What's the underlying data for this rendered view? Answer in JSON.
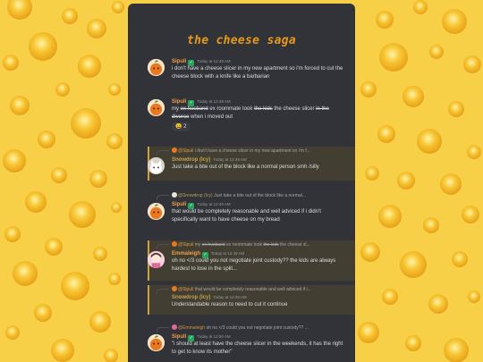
{
  "page": {
    "title": "the cheese saga"
  },
  "messages": [
    {
      "user": "Sipuli",
      "time": "Today at 12:48 AM",
      "text": "i don't have a cheese slicer in my new apartment so i'm forced to cut the cheese block with a knife like a barbarian"
    },
    {
      "user": "Sipuli",
      "time": "Today at 12:48 AM",
      "text_parts": [
        "my ",
        "ex husband",
        " ex roommate took ",
        "the kids",
        " the cheese slicer ",
        "in the divorce",
        " when i moved out"
      ],
      "reaction": {
        "emoji": "😩",
        "count": "2"
      }
    },
    {
      "reply_user": "@Sipuli",
      "reply_text": "i don't have a cheese slicer in my new apartment so i'm f...",
      "user": "Snowdrop (Icy)",
      "time": "Today at 12:49 AM",
      "text": "Just take a bite out of the block like a normal person smh /silly"
    },
    {
      "reply_user": "@Snowdrop (Icy)",
      "reply_text": "Just take a bite out of the block like a normal...",
      "user": "Sipuli",
      "time": "Today at 12:49 AM",
      "text": "that would be completely reasonable and well adviced if i didn't specifically want to have cheese on my bread"
    },
    {
      "reply_user": "@Sipuli",
      "reply_parts": [
        "my ",
        "ex husband",
        " ex roommate took ",
        "the kids",
        " the cheese sl..."
      ],
      "user": "Emmaleigh",
      "time": "Today at 12:49 AM",
      "text": "oh no </3 could you not negotiate joint custody?? the kids are always hardest to lose in the split..."
    },
    {
      "reply_user": "@Sipuli",
      "reply_text": "that would be completely reasonable and well adviced if i...",
      "user": "Snowdrop (Icy)",
      "time": "Today at 12:49 AM",
      "text": "Understandable reason to need to cut it continue"
    },
    {
      "reply_user": "@Emmaleigh",
      "reply_text": "oh no </3 could you not negotiate joint custody?? ...",
      "user": "Sipuli",
      "time": "Today at 12:50 AM",
      "text": "\"i should at least have the cheese slicer in the weekends, it has the right to get to know its mother\""
    }
  ],
  "colors": {
    "background": "#f7d048",
    "panel": "#313338",
    "title": "#e69a1c",
    "sipuli_name": "#f0a04b",
    "snowdrop_name": "#c0a44e",
    "emmaleigh_name": "#f0a04b",
    "highlight": "#433e32",
    "badge": "#23a55a"
  },
  "icons": {
    "verified": "checkmark-badge-icon",
    "sipuli_avatar": "orange-blob-avatar",
    "snowdrop_avatar": "white-cat-avatar",
    "emmaleigh_avatar": "pink-character-avatar"
  }
}
